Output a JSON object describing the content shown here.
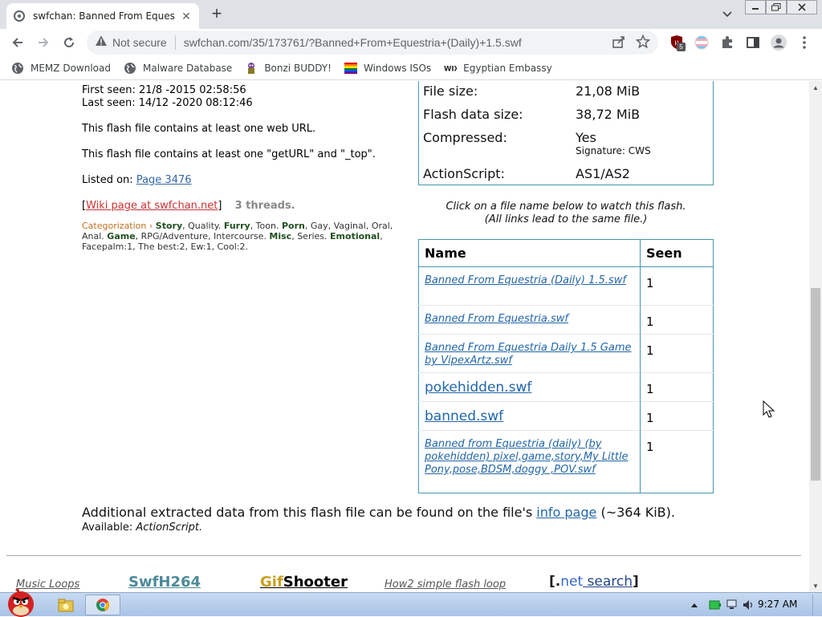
{
  "browser": {
    "tab_title": "swfchan: Banned From Equestria",
    "security_label": "Not secure",
    "url": "swfchan.com/35/173761/?Banned+From+Equestria+(Daily)+1.5.swf",
    "extension_badge": "5",
    "bookmarks": [
      {
        "label": "MEMZ Download",
        "icon": "globe-icon"
      },
      {
        "label": "Malware Database",
        "icon": "globe-icon"
      },
      {
        "label": "Bonzi BUDDY!",
        "icon": "bonzi-icon"
      },
      {
        "label": "Windows ISOs",
        "icon": "rainbow-flag-icon"
      },
      {
        "label": "Egyptian Embassy",
        "icon": "wix-icon"
      }
    ]
  },
  "page": {
    "first_seen": "First seen: 21/8 -2015 02:58:56",
    "last_seen": "Last seen: 14/12 -2020 08:12:46",
    "web_url_note": "This flash file contains at least one web URL.",
    "geturl_note": "This flash file contains at least one \"getURL\" and \"_top\".",
    "listed_on_label": "Listed on:",
    "listed_on_link": "Page 3476",
    "wiki_open": "[",
    "wiki_link": "Wiki page at swfchan.net",
    "wiki_close": "]",
    "threads": "3 threads.",
    "categorization": {
      "lead": "Categorization ›",
      "story": "Story",
      "story_rest": ", Quality.",
      "furry": "Furry",
      "furry_rest": ", Toon.",
      "porn": "Porn",
      "porn_rest": ", Gay, Vaginal, Oral, Anal.",
      "game": "Game",
      "game_rest": ", RPG/Adventure, Intercourse.",
      "misc": "Misc",
      "misc_rest": ", Series.",
      "emotional": "Emotional",
      "emotional_rest": ",",
      "ratings": "Facepalm:1, The best:2, Ew:1, Cool:2."
    },
    "info": {
      "file_size_label": "File size:",
      "file_size": "21,08 MiB",
      "flash_size_label": "Flash data size:",
      "flash_size": "38,72 MiB",
      "compressed_label": "Compressed:",
      "compressed": "Yes",
      "signature": "Signature: CWS",
      "actionscript_label": "ActionScript:",
      "actionscript": "AS1/AS2"
    },
    "watch_note_1": "Click on a file name below to watch this flash.",
    "watch_note_2": "(All links lead to the same file.)",
    "files_table": {
      "headers": [
        "Name",
        "Seen"
      ],
      "rows": [
        {
          "name": "Banned From Equestria (Daily) 1.5.swf",
          "seen": "1"
        },
        {
          "name": "Banned From Equestria.swf",
          "seen": "1"
        },
        {
          "name": "Banned From Equestria Daily 1.5 Game by VipexArtz.swf",
          "seen": "1"
        },
        {
          "name": "pokehidden.swf",
          "seen": "1"
        },
        {
          "name": "banned.swf",
          "seen": "1"
        },
        {
          "name": "Banned from Equestria (daily) (by pokehidden) pixel,game,story,My Little Pony,pose,BDSM,doggy ,POV.swf",
          "seen": "1"
        }
      ]
    },
    "extra_text": "Additional extracted data from this flash file can be found on the file's",
    "extra_link": "info page",
    "extra_size": "(~364 KiB).",
    "available_label": "Available:",
    "available_value": "ActionScript.",
    "footer": {
      "music_loops": "Music Loops",
      "swfh264": "SwfH264",
      "gif": "Gif",
      "shooter": "Shooter",
      "flash_loop": "How2 simple flash loop",
      "net_search_open": "[.",
      "net_search_net": "net",
      "net_search_word": " search",
      "net_search_close": "]"
    }
  },
  "taskbar": {
    "clock": "9:27 AM"
  }
}
